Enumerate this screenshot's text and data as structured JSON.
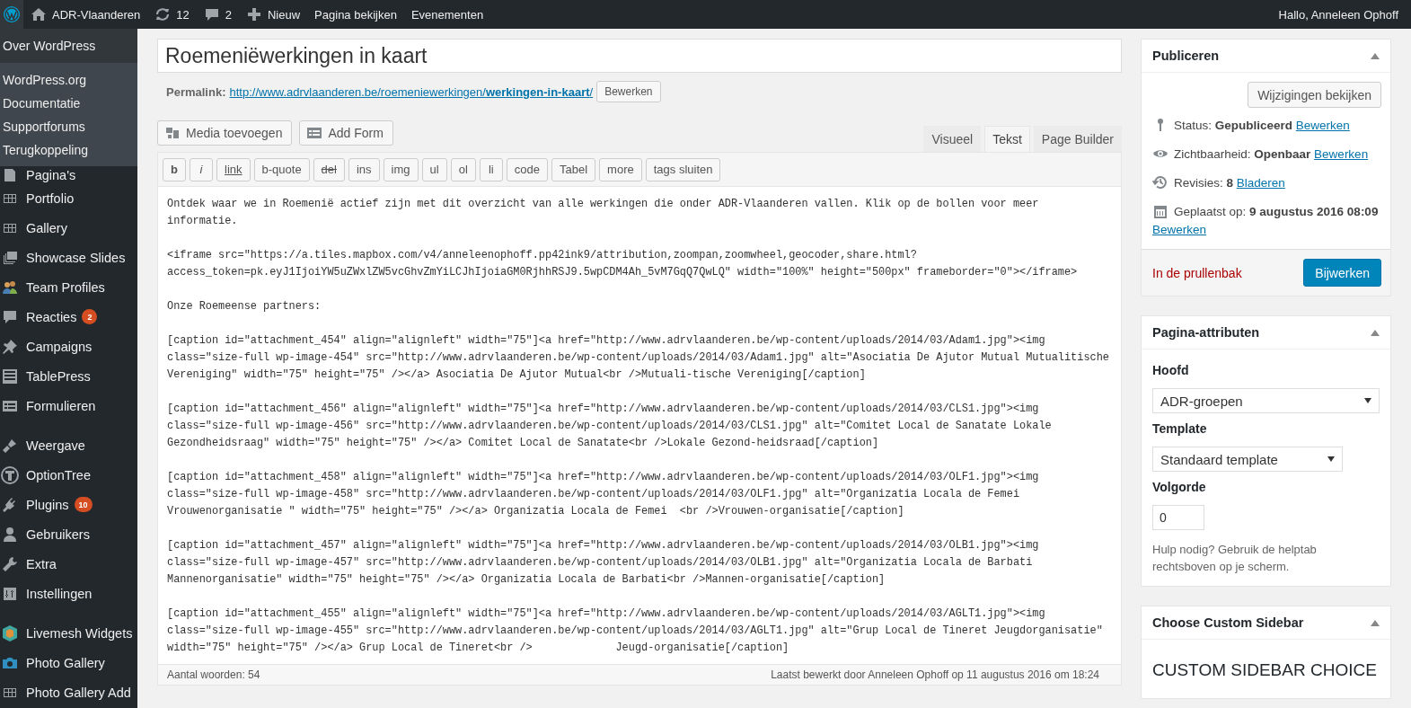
{
  "admin_bar": {
    "site": "ADR-Vlaanderen",
    "updates": "12",
    "comments": "2",
    "new": "Nieuw",
    "links": [
      "Pagina bekijken",
      "Evenementen"
    ],
    "greeting": "Hallo, Anneleen Ophoff"
  },
  "wp_menu": {
    "about": "Over WordPress",
    "links": [
      "WordPress.org",
      "Documentatie",
      "Supportforums",
      "Terugkoppeling"
    ]
  },
  "sidebar": {
    "groups": [
      {
        "items": [
          {
            "label": "Pagina's"
          },
          {
            "label": "Portfolio"
          },
          {
            "label": "Gallery"
          },
          {
            "label": "Showcase Slides"
          },
          {
            "label": "Team Profiles"
          },
          {
            "label": "Reacties",
            "badge": "2"
          },
          {
            "label": "Campaigns"
          },
          {
            "label": "TablePress"
          },
          {
            "label": "Formulieren"
          }
        ]
      },
      {
        "items": [
          {
            "label": "Weergave"
          },
          {
            "label": "OptionTree"
          },
          {
            "label": "Plugins",
            "badge": "10"
          },
          {
            "label": "Gebruikers"
          },
          {
            "label": "Extra"
          },
          {
            "label": "Instellingen"
          }
        ]
      },
      {
        "items": [
          {
            "label": "Livemesh Widgets"
          },
          {
            "label": "Photo Gallery"
          },
          {
            "label": "Photo Gallery Add"
          }
        ]
      }
    ]
  },
  "title": "Roemeniëwerkingen in kaart",
  "permalink": {
    "label": "Permalink:",
    "url": "http://www.adrvlaanderen.be/roemeniewerkingen/**werkingen-in-kaart**/",
    "button": "Bewerken"
  },
  "media_buttons": [
    "Media toevoegen",
    "Add Form"
  ],
  "editor_tabs": [
    {
      "label": "Visueel",
      "selected": false
    },
    {
      "label": "Tekst",
      "selected": true
    },
    {
      "label": "Page Builder",
      "selected": false
    }
  ],
  "quicktags": [
    {
      "label": "b",
      "kind": "bold"
    },
    {
      "label": "i",
      "kind": "italic"
    },
    {
      "label": "link",
      "kind": "underline"
    },
    {
      "label": "b-quote",
      "kind": "plain"
    },
    {
      "label": "del",
      "kind": "strike"
    },
    {
      "label": "ins",
      "kind": "plain"
    },
    {
      "label": "img",
      "kind": "plain"
    },
    {
      "label": "ul",
      "kind": "plain"
    },
    {
      "label": "ol",
      "kind": "plain"
    },
    {
      "label": "li",
      "kind": "plain"
    },
    {
      "label": "code",
      "kind": "plain"
    },
    {
      "label": "Tabel",
      "kind": "plain"
    },
    {
      "label": "more",
      "kind": "plain"
    },
    {
      "label": "tags sluiten",
      "kind": "plain"
    }
  ],
  "content": [
    [
      "Ontdek waar we in Roemenië actief zijn met dit overzicht van alle werkingen die onder ADR-Vlaanderen vallen. Klik op de bollen voor meer",
      "informatie."
    ],
    [
      "<iframe src=\"https://a.tiles.mapbox.com/v4/anneleenophoff.pp42ink9/attribution,zoompan,zoomwheel,geocoder,share.html?",
      "access_token=pk.eyJ1IjoiYW5uZWxlZW5vcGhvZmYiLCJhIjoiaGM0RjhhRSJ9.5wpCDM4Ah_5vM7GqQ7QwLQ\" width=\"100%\" height=\"500px\" frameborder=\"0\"></iframe>"
    ],
    [
      "Onze Roemeense partners:"
    ],
    [
      "[caption id=\"attachment_454\" align=\"alignleft\" width=\"75\"]<a href=\"http://www.adrvlaanderen.be/wp-content/uploads/2014/03/Adam1.jpg\"><img",
      "class=\"size-full wp-image-454\" src=\"http://www.adrvlaanderen.be/wp-content/uploads/2014/03/Adam1.jpg\" alt=\"Asociatia De Ajutor Mutual Mutualitische",
      "Vereniging\" width=\"75\" height=\"75\" /></a> Asociatia De Ajutor Mutual<br />Mutuali-tische Vereniging[/caption]"
    ],
    [
      "[caption id=\"attachment_456\" align=\"alignleft\" width=\"75\"]<a href=\"http://www.adrvlaanderen.be/wp-content/uploads/2014/03/CLS1.jpg\"><img",
      "class=\"size-full wp-image-456\" src=\"http://www.adrvlaanderen.be/wp-content/uploads/2014/03/CLS1.jpg\" alt=\"Comitet Local de Sanatate Lokale",
      "Gezondheidsraag\" width=\"75\" height=\"75\" /></a> Comitet Local de Sanatate<br />Lokale Gezond-heidsraad[/caption]"
    ],
    [
      "[caption id=\"attachment_458\" align=\"alignleft\" width=\"75\"]<a href=\"http://www.adrvlaanderen.be/wp-content/uploads/2014/03/OLF1.jpg\"><img",
      "class=\"size-full wp-image-458\" src=\"http://www.adrvlaanderen.be/wp-content/uploads/2014/03/OLF1.jpg\" alt=\"Organizatia Locala de Femei",
      "Vrouwenorganisatie \" width=\"75\" height=\"75\" /></a> Organizatia Locala de Femei  <br />Vrouwen-organisatie[/caption]"
    ],
    [
      "[caption id=\"attachment_457\" align=\"alignleft\" width=\"75\"]<a href=\"http://www.adrvlaanderen.be/wp-content/uploads/2014/03/OLB1.jpg\"><img",
      "class=\"size-full wp-image-457\" src=\"http://www.adrvlaanderen.be/wp-content/uploads/2014/03/OLB1.jpg\" alt=\"Organizatia Locala de Barbati",
      "Mannenorganisatie\" width=\"75\" height=\"75\" /></a> Organizatia Locala de Barbati<br />Mannen-organisatie[/caption]"
    ],
    [
      "[caption id=\"attachment_455\" align=\"alignleft\" width=\"75\"]<a href=\"http://www.adrvlaanderen.be/wp-content/uploads/2014/03/AGLT1.jpg\"><img",
      "class=\"size-full wp-image-455\" src=\"http://www.adrvlaanderen.be/wp-content/uploads/2014/03/AGLT1.jpg\" alt=\"Grup Local de Tineret Jeugdorganisatie\"",
      "width=\"75\" height=\"75\" /></a> Grup Local de Tineret<br />             Jeugd-organisatie[/caption]"
    ]
  ],
  "word_count": "Aantal woorden: 54",
  "last_edited": "Laatst bewerkt door Anneleen Ophoff op 11 augustus 2016 om 18:24",
  "publish_box": {
    "title": "Publiceren",
    "preview_button": "Wijzigingen bekijken",
    "rows": [
      {
        "text": "Status: **Gepubliceerd**",
        "link": "Bewerken"
      },
      {
        "text": "Zichtbaarheid: **Openbaar**",
        "link": "Bewerken"
      },
      {
        "text": "Revisies: **8**",
        "link": "Bladeren"
      },
      {
        "text": "Geplaatst op: **9 augustus 2016 08:09**",
        "link": "Bewerken"
      }
    ],
    "trash": "In de prullenbak",
    "update_button": "Bijwerken"
  },
  "attributes_box": {
    "title": "Pagina-attributen",
    "parent_label": "Hoofd",
    "parent_value": "ADR-groepen",
    "template_label": "Template",
    "template_value": "Standaard template",
    "order_label": "Volgorde",
    "order_value": "0",
    "help": "Hulp nodig? Gebruik de helptab rechtsboven op je scherm."
  },
  "sidebar_box": {
    "title": "Choose Custom Sidebar",
    "heading": "CUSTOM SIDEBAR CHOICE"
  }
}
